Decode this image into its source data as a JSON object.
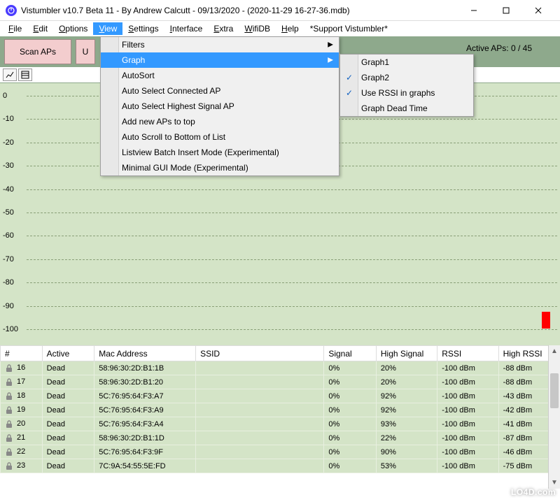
{
  "window": {
    "title": "Vistumbler v10.7 Beta 11 - By Andrew Calcutt - 09/13/2020 - (2020-11-29 16-27-36.mdb)"
  },
  "menubar": {
    "items": [
      "File",
      "Edit",
      "Options",
      "View",
      "Settings",
      "Interface",
      "Extra",
      "WifiDB",
      "Help",
      "*Support Vistumbler*"
    ],
    "active_index": 3
  },
  "toolbar": {
    "scan_label": "Scan APs",
    "truncated_button_label": "U",
    "active_aps_text": "Active APs: 0 / 45"
  },
  "view_menu": {
    "items": [
      {
        "label": "Filters",
        "submenu": true
      },
      {
        "label": "Graph",
        "submenu": true,
        "highlight": true
      },
      {
        "label": "AutoSort"
      },
      {
        "label": "Auto Select Connected AP"
      },
      {
        "label": "Auto Select Highest Signal AP"
      },
      {
        "label": "Add new APs to top"
      },
      {
        "label": "Auto Scroll to Bottom of List"
      },
      {
        "label": "Listview Batch Insert Mode (Experimental)"
      },
      {
        "label": "Minimal GUI Mode (Experimental)"
      }
    ]
  },
  "graph_submenu": {
    "items": [
      {
        "label": "Graph1",
        "checked": false
      },
      {
        "label": "Graph2",
        "checked": true
      },
      {
        "label": "Use RSSI in graphs",
        "checked": true
      },
      {
        "label": "Graph Dead Time",
        "checked": false
      }
    ]
  },
  "chart_data": {
    "type": "line",
    "title": "",
    "xlabel": "",
    "ylabel": "",
    "ylim": [
      -100,
      0
    ],
    "yticks": [
      0,
      -10,
      -20,
      -30,
      -40,
      -50,
      -60,
      -70,
      -80,
      -90,
      -100
    ],
    "series": []
  },
  "table": {
    "columns": [
      "#",
      "Active",
      "Mac Address",
      "SSID",
      "Signal",
      "High Signal",
      "RSSI",
      "High RSSI"
    ],
    "rows": [
      {
        "num": "16",
        "active": "Dead",
        "mac": "58:96:30:2D:B1:1B",
        "ssid": "",
        "signal": "0%",
        "high_signal": "20%",
        "rssi": "-100 dBm",
        "high_rssi": "-88 dBm"
      },
      {
        "num": "17",
        "active": "Dead",
        "mac": "58:96:30:2D:B1:20",
        "ssid": "",
        "signal": "0%",
        "high_signal": "20%",
        "rssi": "-100 dBm",
        "high_rssi": "-88 dBm"
      },
      {
        "num": "18",
        "active": "Dead",
        "mac": "5C:76:95:64:F3:A7",
        "ssid": "",
        "signal": "0%",
        "high_signal": "92%",
        "rssi": "-100 dBm",
        "high_rssi": "-43 dBm"
      },
      {
        "num": "19",
        "active": "Dead",
        "mac": "5C:76:95:64:F3:A9",
        "ssid": "",
        "signal": "0%",
        "high_signal": "92%",
        "rssi": "-100 dBm",
        "high_rssi": "-42 dBm"
      },
      {
        "num": "20",
        "active": "Dead",
        "mac": "5C:76:95:64:F3:A4",
        "ssid": "",
        "signal": "0%",
        "high_signal": "93%",
        "rssi": "-100 dBm",
        "high_rssi": "-41 dBm"
      },
      {
        "num": "21",
        "active": "Dead",
        "mac": "58:96:30:2D:B1:1D",
        "ssid": "",
        "signal": "0%",
        "high_signal": "22%",
        "rssi": "-100 dBm",
        "high_rssi": "-87 dBm"
      },
      {
        "num": "22",
        "active": "Dead",
        "mac": "5C:76:95:64:F3:9F",
        "ssid": "",
        "signal": "0%",
        "high_signal": "90%",
        "rssi": "-100 dBm",
        "high_rssi": "-46 dBm"
      },
      {
        "num": "23",
        "active": "Dead",
        "mac": "7C:9A:54:55:5E:FD",
        "ssid": "",
        "signal": "0%",
        "high_signal": "53%",
        "rssi": "-100 dBm",
        "high_rssi": "-75 dBm"
      }
    ]
  },
  "watermark": {
    "text": "LO4D.com"
  }
}
